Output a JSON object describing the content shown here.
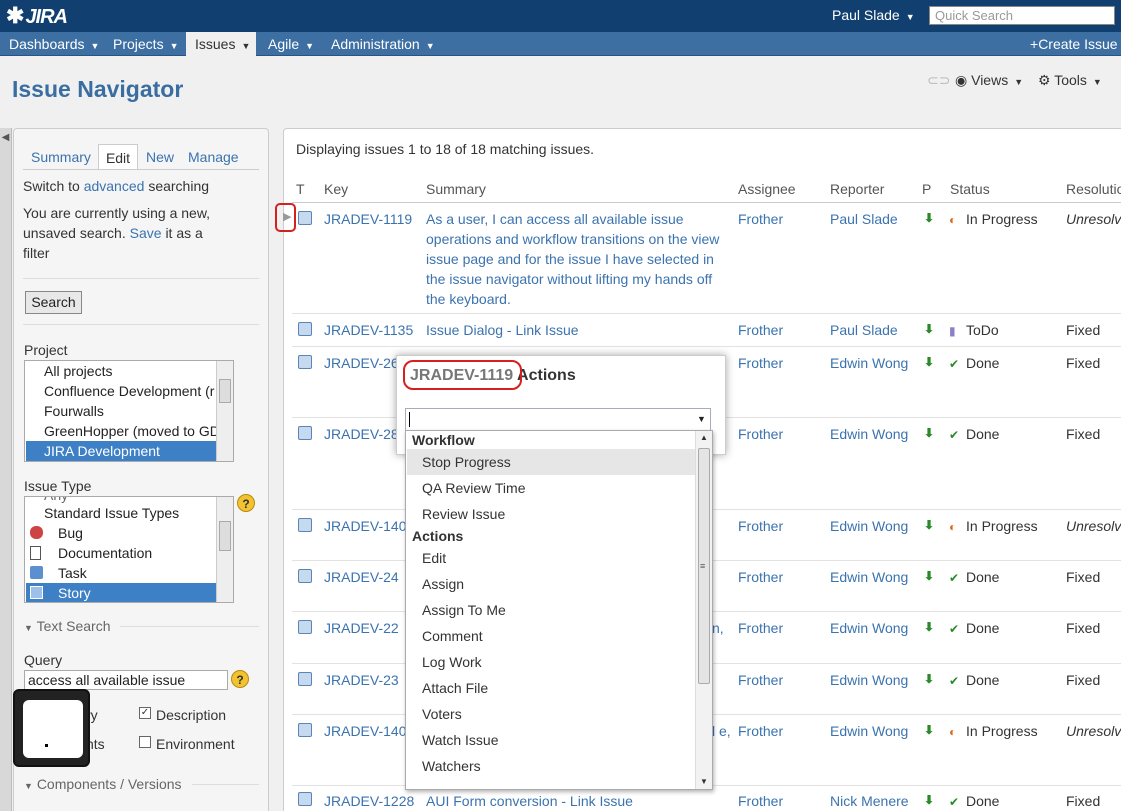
{
  "header": {
    "logo": "JIRA",
    "user": "Paul Slade",
    "quick_search_placeholder": "Quick Search"
  },
  "nav": {
    "items": [
      "Dashboards",
      "Projects",
      "Issues",
      "Agile",
      "Administration"
    ],
    "active": "Issues",
    "create_issue": "Create Issue"
  },
  "page": {
    "title": "Issue Navigator",
    "views": "Views",
    "tools": "Tools"
  },
  "left": {
    "tabs": [
      "Summary",
      "Edit",
      "New",
      "Manage"
    ],
    "switch_prefix": "Switch to",
    "switch_link": "advanced",
    "switch_suffix": "searching",
    "unsaved_line1": "You are currently using a new,",
    "unsaved_line2a": "unsaved search.",
    "unsaved_save": "Save",
    "unsaved_line2b": "it as a",
    "unsaved_line3": "filter",
    "search_button": "Search",
    "project_label": "Project",
    "projects": [
      "All projects",
      "Confluence Development (r",
      "Fourwalls",
      "GreenHopper (moved to GD",
      "JIRA Development"
    ],
    "project_selected": "JIRA Development",
    "issue_type_label": "Issue Type",
    "issue_types_partial": "Any",
    "issue_types": [
      "Standard Issue Types",
      "Bug",
      "Documentation",
      "Task",
      "Story"
    ],
    "issue_type_selected": "Story",
    "text_search_label": "Text Search",
    "query_label": "Query",
    "query_value": "access all available issue",
    "cb_summary": "ry",
    "cb_description": "Description",
    "cb_comments": "nts",
    "cb_environment": "Environment",
    "components_label": "Components / Versions"
  },
  "results": {
    "displaying": "Displaying issues 1 to 18 of 18 matching issues.",
    "columns": [
      "T",
      "Key",
      "Summary",
      "Assignee",
      "Reporter",
      "P",
      "Status",
      "Resolutio"
    ],
    "rows": [
      {
        "key": "JRADEV-1119",
        "summary": "As a user, I can access all available issue operations and workflow transitions on the view issue page and for the issue I have selected in the issue navigator without lifting my hands off the keyboard.",
        "assignee": "Frother",
        "reporter": "Paul Slade",
        "status": "In Progress",
        "resolution": "Unresolv"
      },
      {
        "key": "JRADEV-1135",
        "summary": "Issue Dialog - Link Issue",
        "assignee": "Frother",
        "reporter": "Paul Slade",
        "status": "ToDo",
        "resolution": "Fixed"
      },
      {
        "key": "JRADEV-26",
        "summary": "",
        "assignee": "Frother",
        "reporter": "Edwin Wong",
        "status": "Done",
        "resolution": "Fixed"
      },
      {
        "key": "JRADEV-28",
        "summary": "",
        "assignee": "Frother",
        "reporter": "Edwin Wong",
        "status": "Done",
        "resolution": "Fixed"
      },
      {
        "key": "JRADEV-140",
        "summary": "",
        "assignee": "Frother",
        "reporter": "Edwin Wong",
        "status": "In Progress",
        "resolution": "Unresolv"
      },
      {
        "key": "JRADEV-24",
        "summary": "",
        "assignee": "Frother",
        "reporter": "Edwin Wong",
        "status": "Done",
        "resolution": "Fixed"
      },
      {
        "key": "JRADEV-22",
        "summary": "n,",
        "assignee": "Frother",
        "reporter": "Edwin Wong",
        "status": "Done",
        "resolution": "Fixed"
      },
      {
        "key": "JRADEV-23",
        "summary": "",
        "assignee": "Frother",
        "reporter": "Edwin Wong",
        "status": "Done",
        "resolution": "Fixed"
      },
      {
        "key": "JRADEV-140",
        "summary": "l e,",
        "assignee": "Frother",
        "reporter": "Edwin Wong",
        "status": "In Progress",
        "resolution": "Unresolv"
      },
      {
        "key": "JRADEV-1228",
        "summary": "AUI Form conversion - Link Issue",
        "assignee": "Frother",
        "reporter": "Nick Menere",
        "status": "Done",
        "resolution": "Fixed"
      }
    ]
  },
  "dialog": {
    "issue_key": "JRADEV-1119",
    "title_suffix": "Actions",
    "input_value": "",
    "groups": [
      {
        "label": "Workflow",
        "items": [
          "Stop Progress",
          "QA Review Time",
          "Review Issue"
        ]
      },
      {
        "label": "Actions",
        "items": [
          "Edit",
          "Assign",
          "Assign To Me",
          "Comment",
          "Log Work",
          "Attach File",
          "Voters",
          "Watch Issue",
          "Watchers"
        ]
      }
    ],
    "highlighted": "Stop Progress"
  },
  "colors": {
    "topbar": "#114070",
    "navbar": "#3d6fa3",
    "link": "#3b73af",
    "highlight_ring": "#d61f1f",
    "selected": "#3d80c6"
  }
}
